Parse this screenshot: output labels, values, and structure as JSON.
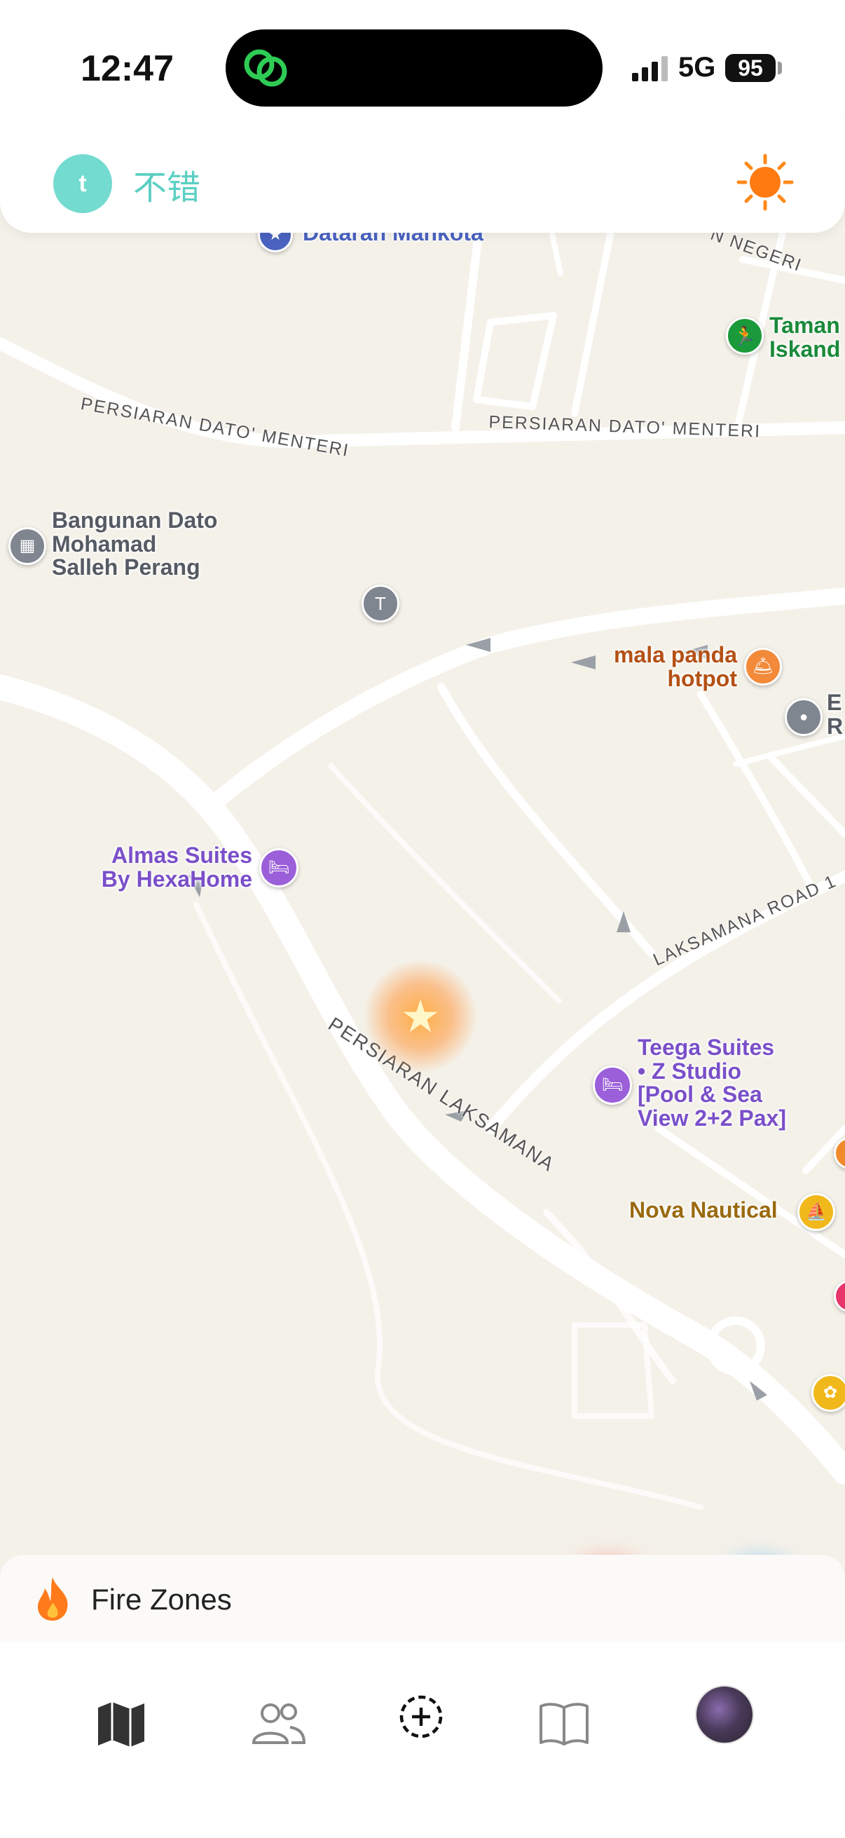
{
  "status_bar": {
    "time": "12:47",
    "network": "5G",
    "battery": "95"
  },
  "header": {
    "avatar_letter": "t",
    "title": "不错"
  },
  "map": {
    "streets": {
      "persiaran_dato_menteri_left": "PERSIARAN DATO' MENTERI",
      "persiaran_dato_menteri_right": "PERSIARAN DATO' MENTERI",
      "persiaran_laksamana": "PERSIARAN LAKSAMANA",
      "laksamana_road_1": "LAKSAMANA ROAD 1",
      "negeri": "N NEGERI"
    },
    "places": {
      "dataran": "Dataran Mahkota",
      "taman": "Taman\nIskand",
      "bangunan": "Bangunan Dato\nMohamad\nSalleh Perang",
      "mala_panda": "mala panda\nhotpot",
      "almas": "Almas Suites\nBy HexaHome",
      "teega": "Teega Suites\n• Z Studio\n[Pool & Sea\nView 2+2 Pax]",
      "nova": "Nova Nautical",
      "er": "E\nR"
    },
    "colors": {
      "poi_purple": "#7a4fc9",
      "poi_brown": "#b45014",
      "poi_gold": "#9a6a10",
      "poi_green": "#1a8a3a",
      "poi_blue": "#4a63c0"
    }
  },
  "fire_zones": {
    "label": "Fire Zones"
  },
  "tabs": [
    "map-icon",
    "friends-icon",
    "add-icon",
    "book-icon",
    "profile-avatar"
  ]
}
